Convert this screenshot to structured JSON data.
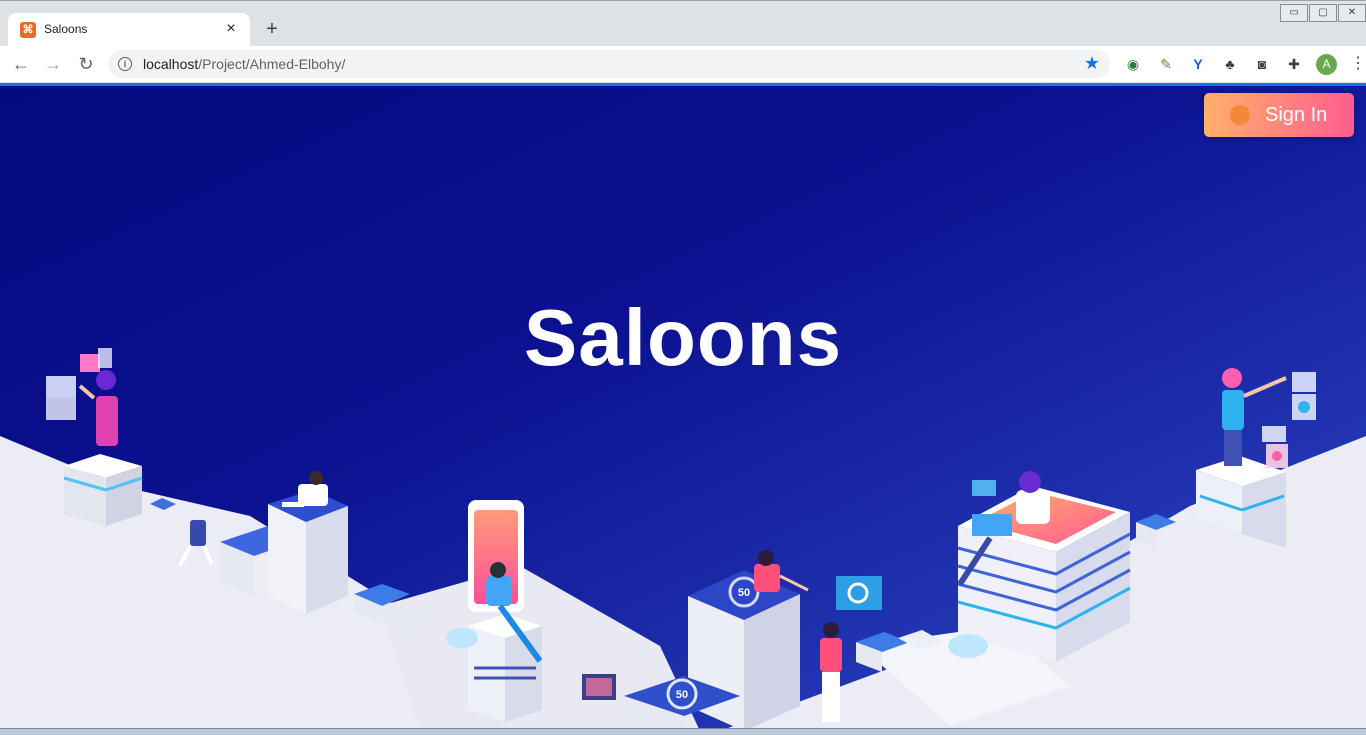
{
  "browser": {
    "tab_title": "Saloons",
    "tab_close": "×",
    "new_tab": "+",
    "url_host": "localhost",
    "url_path": "/Project/Ahmed-Elbohy/",
    "profile_initial": "A",
    "window_buttons": [
      "▭",
      "▢",
      "✕"
    ]
  },
  "page": {
    "title": "Saloons",
    "signin_label": "Sign In"
  },
  "illustration": {
    "badge_values": [
      "50",
      "50"
    ]
  },
  "colors": {
    "bg_dark": "#05097f",
    "bg_light": "#3a55cf",
    "signin_start": "#ffb06a",
    "signin_end": "#ff5d8f",
    "accent": "#1a73e8"
  }
}
